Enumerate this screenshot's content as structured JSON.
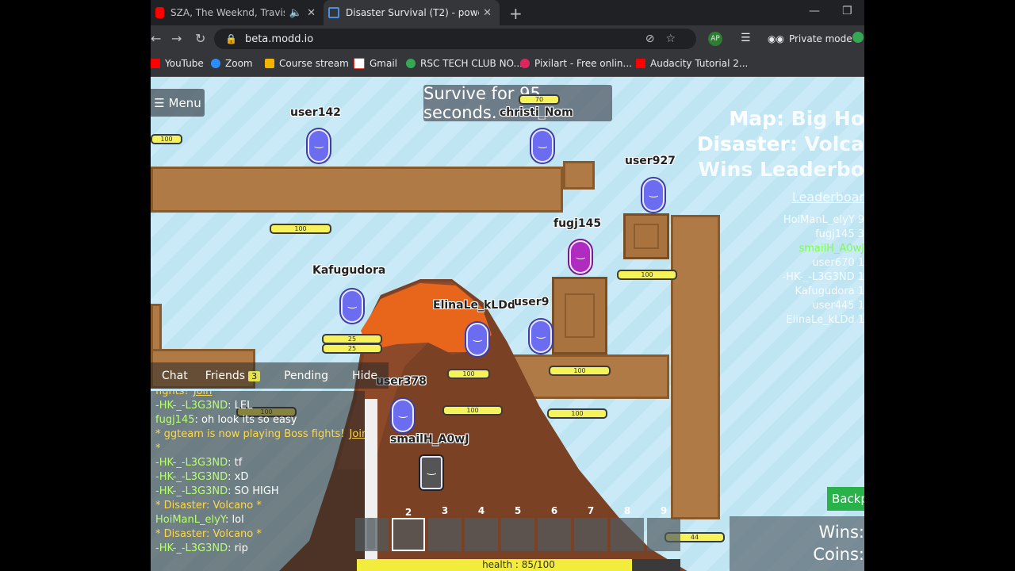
{
  "browser": {
    "tabs": [
      {
        "title": "SZA, The Weeknd, Travis Scott",
        "icon": "youtube-icon"
      },
      {
        "title": "Disaster Survival (T2) - powered b",
        "icon": "modd-icon"
      }
    ],
    "url": "beta.modd.io",
    "private_mode": "Private mode",
    "bookmarks": [
      "YouTube",
      "Zoom",
      "Course stream",
      "Gmail",
      "RSC TECH CLUB NO...",
      "Pixilart - Free onlin...",
      "Audacity Tutorial 2..."
    ]
  },
  "game": {
    "menu": "☰ Menu",
    "objective": "Survive for 95 seconds.",
    "map_label": "Map",
    "map_value": ": Big Ho",
    "disaster_label": "Disaster",
    "disaster_value": ": Volca",
    "wins_leaderboard": "Wins Leaderbo",
    "leaderboard_link": "Leaderboar",
    "leaderboard": [
      {
        "name": "HoiManL_elyY 9",
        "highlight": false
      },
      {
        "name": "fugj145 3",
        "highlight": false
      },
      {
        "name": "smailH_A0wJ",
        "highlight": true
      },
      {
        "name": "user670 1",
        "highlight": false
      },
      {
        "name": "-HK-_-L3G3ND 1",
        "highlight": false
      },
      {
        "name": "Kafugudora 1",
        "highlight": false
      },
      {
        "name": "user445 1",
        "highlight": false
      },
      {
        "name": "ElinaLe_kLDd 1",
        "highlight": false
      }
    ],
    "players": [
      "user142",
      "christi_Nom",
      "user927",
      "fugj145",
      "Kafugudora",
      "ElinaLe_kLDd",
      "user9",
      "user378",
      "smailH_A0wJ"
    ],
    "health_values": [
      "100",
      "100",
      "25",
      "25",
      "100",
      "100",
      "100",
      "100",
      "100",
      "100",
      "100",
      "44",
      "70"
    ],
    "chat": {
      "tabs": [
        "Chat",
        "Friends",
        "Pending",
        "Hide"
      ],
      "friends_count": "3",
      "lines": [
        {
          "user": "fights!",
          "text": "",
          "sys": "",
          "join": "Join"
        },
        {
          "user": "-HK-_-L3G3ND",
          "text": ": LEL",
          "sys": "",
          "join": ""
        },
        {
          "user": "fugj145",
          "text": ": oh look its so easy",
          "sys": "",
          "join": ""
        },
        {
          "user": "",
          "text": "",
          "sys": "* ggteam is now playing Boss fights!",
          "join": "Join"
        },
        {
          "user": "",
          "text": "",
          "sys": "*",
          "join": ""
        },
        {
          "user": "-HK-_-L3G3ND",
          "text": ": tf",
          "sys": "",
          "join": ""
        },
        {
          "user": "-HK-_-L3G3ND",
          "text": ": xD",
          "sys": "",
          "join": ""
        },
        {
          "user": "-HK-_-L3G3ND",
          "text": ": SO HIGH",
          "sys": "",
          "join": ""
        },
        {
          "user": "",
          "text": "",
          "sys": "* Disaster: Volcano *",
          "join": ""
        },
        {
          "user": "HoiManL_elyY",
          "text": ": lol",
          "sys": "",
          "join": ""
        },
        {
          "user": "",
          "text": "",
          "sys": "* Disaster: Volcano *",
          "join": ""
        },
        {
          "user": "-HK-_-L3G3ND",
          "text": ": rip",
          "sys": "",
          "join": ""
        }
      ]
    },
    "hotbar": [
      "",
      "2",
      "3",
      "4",
      "5",
      "6",
      "7",
      "8",
      "9"
    ],
    "health": {
      "text": "health : 85/100",
      "fraction": 0.85
    },
    "wins": "Wins: ",
    "coins": "Coins: ",
    "backpack": "Backp"
  }
}
